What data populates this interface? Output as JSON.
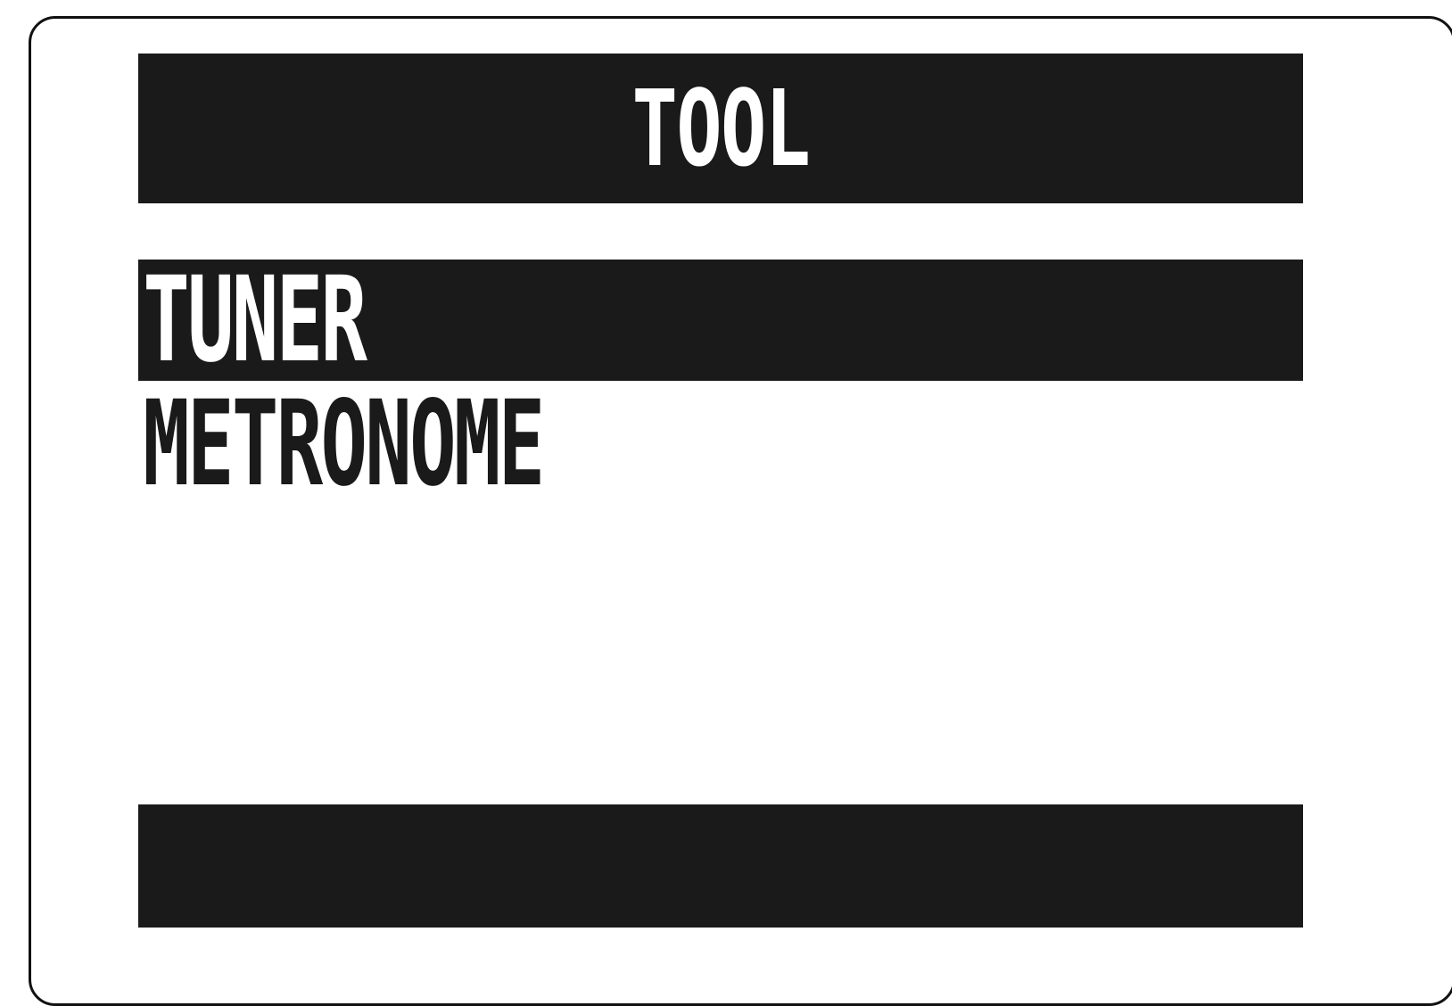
{
  "screen": {
    "title": "TOOL",
    "menu_items": [
      {
        "label": "TUNER",
        "selected": true
      },
      {
        "label": "METRONOME",
        "selected": false
      }
    ]
  },
  "colors": {
    "background": "#ffffff",
    "bar": "#1a1a1a",
    "text_on_bar": "#ffffff"
  }
}
